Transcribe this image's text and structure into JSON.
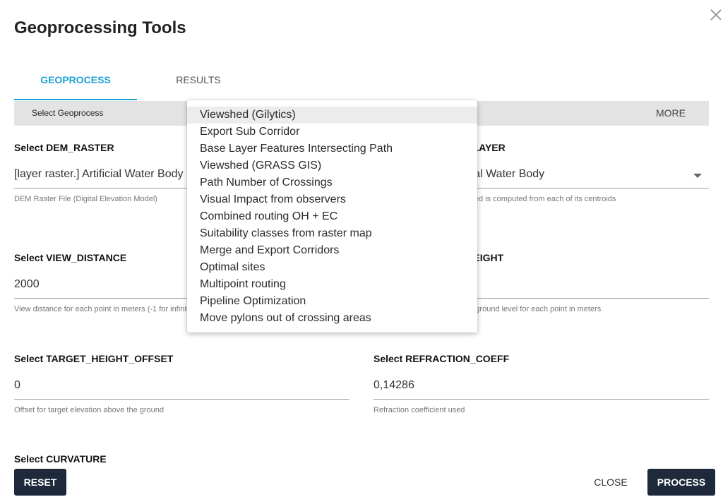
{
  "dialog": {
    "title": "Geoprocessing Tools"
  },
  "tabs": [
    {
      "label": "GEOPROCESS",
      "active": true
    },
    {
      "label": "RESULTS",
      "active": false
    }
  ],
  "bar": {
    "label": "Select Geoprocess",
    "more": "MORE"
  },
  "fields": {
    "dem_raster": {
      "label": "Select DEM_RASTER",
      "value": "[layer raster.] Artificial Water Body",
      "help": "DEM Raster File (Digital Elevation Model)"
    },
    "observers": {
      "label": "Select OBSERVERS_LAYER",
      "value": "[layer vector.] Artificial Water Body",
      "help": "Layer with observers. Viewshed is computed from each of its centroids"
    },
    "view_distance": {
      "label": "Select VIEW_DISTANCE",
      "value": "2000",
      "help": "View distance for each point in meters (-1 for infinity)"
    },
    "observer_height": {
      "label": "Select OBSERVER_HEIGHT",
      "value": "",
      "help": "Height of the observer above ground level for each point in meters"
    },
    "target_height": {
      "label": "Select TARGET_HEIGHT_OFFSET",
      "value": "0",
      "help": "Offset for target elevation above the ground"
    },
    "refraction": {
      "label": "Select REFRACTION_COEFF",
      "value": "0,14286",
      "help": "Refraction coefficient used"
    },
    "curvature": {
      "label": "Select CURVATURE"
    }
  },
  "menu": {
    "items": [
      "Viewshed (Gilytics)",
      "Export Sub Corridor",
      "Base Layer Features Intersecting Path",
      "Viewshed (GRASS GIS)",
      "Path Number of Crossings",
      "Visual Impact from observers",
      "Combined routing OH + EC",
      "Suitability classes from raster map",
      "Merge and Export Corridors",
      "Optimal sites",
      "Multipoint routing",
      "Pipeline Optimization",
      "Move pylons out of crossing areas"
    ],
    "selected_index": 0
  },
  "footer": {
    "reset": "RESET",
    "close": "CLOSE",
    "process": "PROCESS"
  },
  "colors": {
    "accent": "#1ba3d6",
    "button_dark": "#1e2a3b",
    "bar_bg": "#e3e3e3"
  },
  "icons": {
    "close": "close-icon",
    "dropdown": "chevron-down-icon"
  }
}
